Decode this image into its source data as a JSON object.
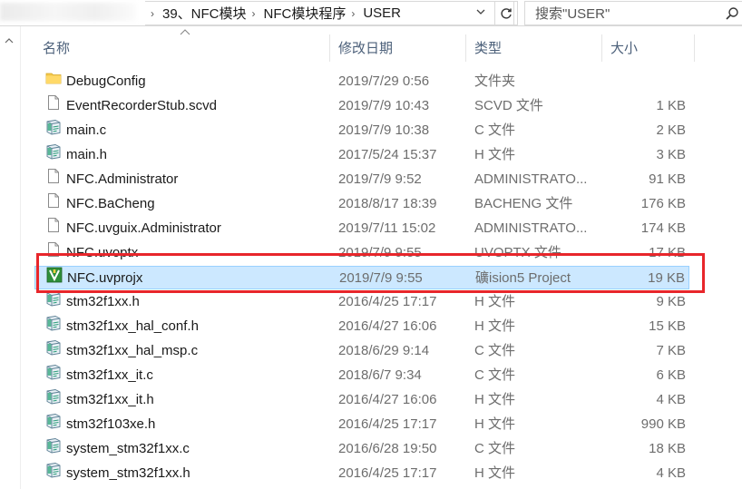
{
  "address": {
    "crumbs": [
      "39、NFC模块",
      "NFC模块程序",
      "USER"
    ],
    "search_placeholder": "搜索\"USER\""
  },
  "columns": {
    "name": "名称",
    "date": "修改日期",
    "type": "类型",
    "size": "大小"
  },
  "files": [
    {
      "name": "DebugConfig",
      "date": "2019/7/29 0:56",
      "type": "文件夹",
      "size": "",
      "icon": "folder-icon"
    },
    {
      "name": "EventRecorderStub.scvd",
      "date": "2019/7/9 10:43",
      "type": "SCVD 文件",
      "size": "1 KB",
      "icon": "file-icon"
    },
    {
      "name": "main.c",
      "date": "2019/7/9 10:38",
      "type": "C 文件",
      "size": "2 KB",
      "icon": "source-file-icon"
    },
    {
      "name": "main.h",
      "date": "2017/5/24 15:37",
      "type": "H 文件",
      "size": "3 KB",
      "icon": "source-file-icon"
    },
    {
      "name": "NFC.Administrator",
      "date": "2019/7/9 9:52",
      "type": "ADMINISTRATO...",
      "size": "91 KB",
      "icon": "file-icon"
    },
    {
      "name": "NFC.BaCheng",
      "date": "2018/8/17 18:39",
      "type": "BACHENG 文件",
      "size": "176 KB",
      "icon": "file-icon"
    },
    {
      "name": "NFC.uvguix.Administrator",
      "date": "2019/7/11 15:02",
      "type": "ADMINISTRATO...",
      "size": "174 KB",
      "icon": "file-icon"
    },
    {
      "name": "NFC.uvoptx",
      "date": "2019/7/9 9:55",
      "type": "UVOPTX 文件",
      "size": "17 KB",
      "icon": "file-icon"
    },
    {
      "name": "NFC.uvprojx",
      "date": "2019/7/9 9:55",
      "type": "礦ision5 Project",
      "size": "19 KB",
      "icon": "keil-project-icon"
    },
    {
      "name": "stm32f1xx.h",
      "date": "2016/4/25 17:17",
      "type": "H 文件",
      "size": "9 KB",
      "icon": "source-file-icon"
    },
    {
      "name": "stm32f1xx_hal_conf.h",
      "date": "2016/4/27 16:06",
      "type": "H 文件",
      "size": "15 KB",
      "icon": "source-file-icon"
    },
    {
      "name": "stm32f1xx_hal_msp.c",
      "date": "2018/6/29 9:14",
      "type": "C 文件",
      "size": "7 KB",
      "icon": "source-file-icon"
    },
    {
      "name": "stm32f1xx_it.c",
      "date": "2018/6/7 9:34",
      "type": "C 文件",
      "size": "6 KB",
      "icon": "source-file-icon"
    },
    {
      "name": "stm32f1xx_it.h",
      "date": "2016/4/27 16:06",
      "type": "H 文件",
      "size": "4 KB",
      "icon": "source-file-icon"
    },
    {
      "name": "stm32f103xe.h",
      "date": "2016/4/25 17:17",
      "type": "H 文件",
      "size": "990 KB",
      "icon": "source-file-icon"
    },
    {
      "name": "system_stm32f1xx.c",
      "date": "2016/6/28 19:50",
      "type": "C 文件",
      "size": "18 KB",
      "icon": "source-file-icon"
    },
    {
      "name": "system_stm32f1xx.h",
      "date": "2016/4/25 17:17",
      "type": "H 文件",
      "size": "4 KB",
      "icon": "source-file-icon"
    }
  ],
  "selected_file": "NFC.uvprojx",
  "colors": {
    "selection_bg": "#cce8ff",
    "selection_border": "#99d1ff",
    "highlight_box": "#e8262b",
    "header_text": "#4c607a"
  }
}
